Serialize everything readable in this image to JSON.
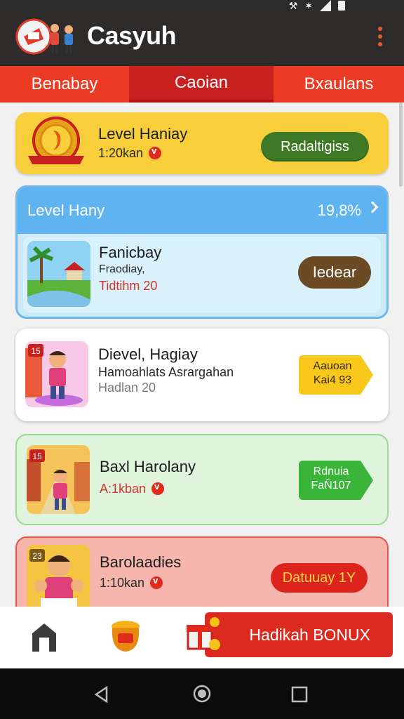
{
  "app": {
    "title": "Casyuh"
  },
  "tabs": [
    {
      "label": "Benabay"
    },
    {
      "label": "Caoian"
    },
    {
      "label": "Bxaulans"
    }
  ],
  "cards": {
    "gold": {
      "title": "Level Haniay",
      "subtitle": "1:20kan",
      "button": "Radaltigiss"
    },
    "blue": {
      "header_label": "Level Hany",
      "header_value": "19,8%",
      "title": "Fanicbay",
      "line1": "Fraodiay,",
      "line2": "Tidtihm 20",
      "button": "Iedear"
    },
    "white": {
      "badge": "15",
      "title": "Dievel, Hagiay",
      "line1": "Hamoahlats Asrargahan",
      "line2": "Hadlan 20",
      "button_line1": "Aauoan",
      "button_line2": "Kai4  93"
    },
    "green": {
      "badge": "15",
      "title": "Baxl Harolany",
      "subtitle": "A:1kban",
      "button_line1": "Rdnuia",
      "button_line2": "FaÑ107"
    },
    "red": {
      "badge": "23",
      "title": "Barolaadies",
      "subtitle": "1:10kan",
      "button": "Datuuay 1Y"
    }
  },
  "bottom_nav": {
    "bonus_label": "Hadikah BONUX"
  },
  "colors": {
    "accent_red": "#ec3b24",
    "gold": "#f8cf3a",
    "blue": "#5fb3f0",
    "green_button": "#3e7a25"
  }
}
